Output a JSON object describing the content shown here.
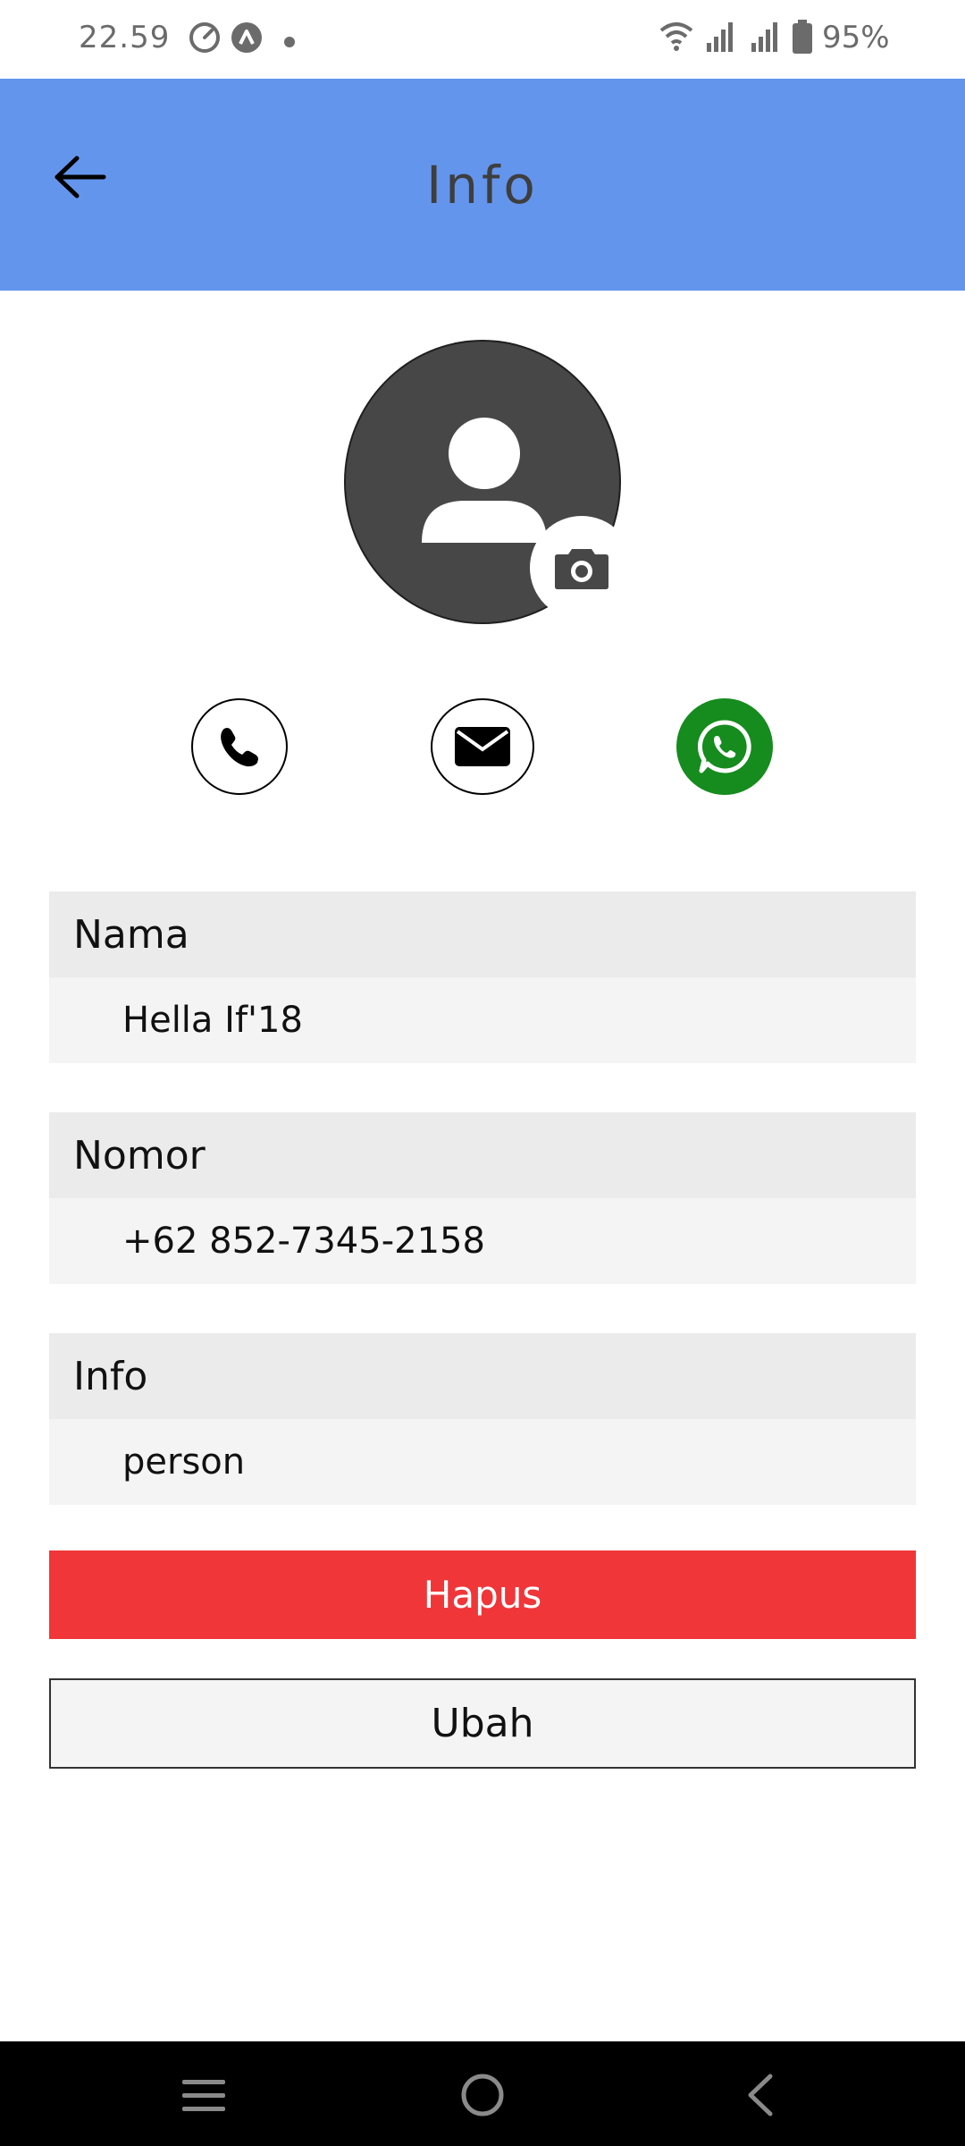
{
  "status_bar": {
    "time": "22.59",
    "battery_percent": "95%",
    "icons": [
      "speedometer-icon",
      "sync-icon",
      "notification-dot-icon",
      "wifi-icon",
      "signal-icon",
      "signal-icon",
      "battery-icon"
    ]
  },
  "app_bar": {
    "title": "Info",
    "background_color": "#6495ed",
    "back_icon": "arrow-left-icon"
  },
  "contact": {
    "avatar_icon": "person-icon",
    "camera_icon": "camera-icon",
    "actions": [
      {
        "name": "call",
        "icon": "phone-icon"
      },
      {
        "name": "email",
        "icon": "mail-icon"
      },
      {
        "name": "whatsapp",
        "icon": "whatsapp-icon",
        "color": "#168b1e"
      }
    ],
    "fields": [
      {
        "label": "Nama",
        "value": "Hella If'18"
      },
      {
        "label": "Nomor",
        "value": "+62 852-7345-2158"
      },
      {
        "label": "Info",
        "value": "person"
      }
    ]
  },
  "buttons": {
    "delete_label": "Hapus",
    "delete_color": "#f03639",
    "edit_label": "Ubah"
  },
  "nav_bar": {
    "icons": [
      "menu-icon",
      "home-icon",
      "back-icon"
    ]
  }
}
